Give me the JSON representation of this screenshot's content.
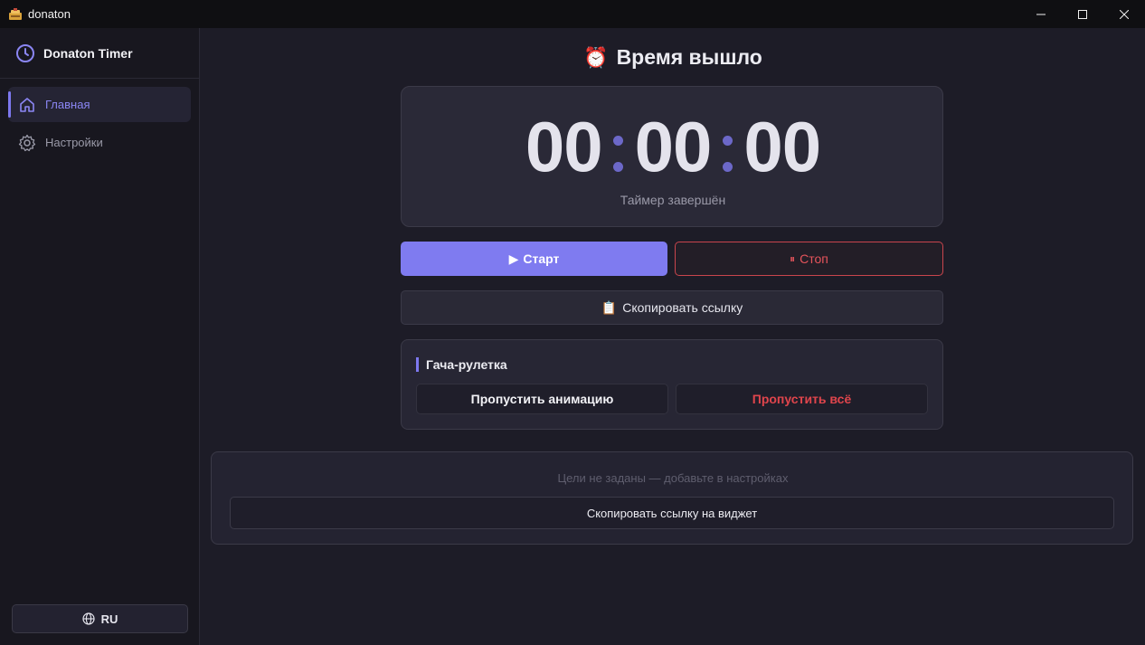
{
  "window": {
    "title": "donaton",
    "icon": "app-logo-icon",
    "controls": [
      "minimize-icon",
      "maximize-icon",
      "close-icon"
    ]
  },
  "sidebar": {
    "brand": {
      "icon": "clock-icon",
      "name": "Donaton Timer"
    },
    "items": [
      {
        "label": "Главная",
        "icon": "home-icon",
        "active": true
      },
      {
        "label": "Настройки",
        "icon": "gear-icon",
        "active": false
      }
    ],
    "language": {
      "icon": "globe-icon",
      "label": "RU"
    }
  },
  "main": {
    "heading": {
      "emoji": "⏰",
      "text": "Время вышло"
    },
    "timer": {
      "hours": "00",
      "minutes": "00",
      "seconds": "00",
      "status": "Таймер завершён"
    },
    "controls": {
      "start_icon": "▶",
      "start_label": "Старт",
      "stop_icon": "⏸",
      "stop_label": "Стоп"
    },
    "copy_link": {
      "icon": "📋",
      "label": "Скопировать ссылку"
    },
    "gacha": {
      "title": "Гача-рулетка",
      "skip_animation_label": "Пропустить анимацию",
      "skip_all_label": "Пропустить всё"
    },
    "goals": {
      "empty_text": "Цели не заданы — добавьте в настройках",
      "widget_button_label": "Скопировать ссылку на виджет"
    }
  },
  "colors": {
    "accent": "#7f7bf0",
    "danger": "#e0454c",
    "background": "#1d1c27",
    "sidebar": "#18171f"
  }
}
